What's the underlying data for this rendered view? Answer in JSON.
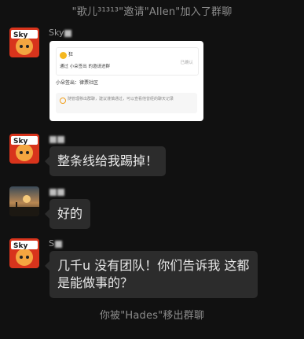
{
  "system": {
    "top_message": "\"歌儿³¹³¹³\"邀请\"Allen\"加入了群聊",
    "bottom_message": "你被\"Hades\"移出群聊"
  },
  "messages": [
    {
      "sender": "Sky",
      "avatar": "sky-game-avatar",
      "type": "image"
    },
    {
      "sender": "S",
      "avatar": "sky-game-avatar",
      "type": "text",
      "text": "整条线给我踢掉！"
    },
    {
      "sender": "",
      "avatar": "sunset-avatar",
      "type": "text",
      "text": "好的"
    },
    {
      "sender": "S",
      "avatar": "sky-game-avatar",
      "type": "text",
      "text": "几千u 没有团队！你们告诉我 这都是能做事的？"
    }
  ],
  "card": {
    "emoji_name": "狂",
    "request_line": "通过  小朵签出  的邀请进群",
    "status": "已确认",
    "note": "小朵签出：律票社区",
    "warning": "随管理移出群聊，建议谨慎通过，可以查看他曾经的聊天记录"
  },
  "colors": {
    "background": "#111111",
    "bubble": "#2c2c2c",
    "bubble_text": "#e9e9e9",
    "system_text": "#8c8c8c"
  }
}
